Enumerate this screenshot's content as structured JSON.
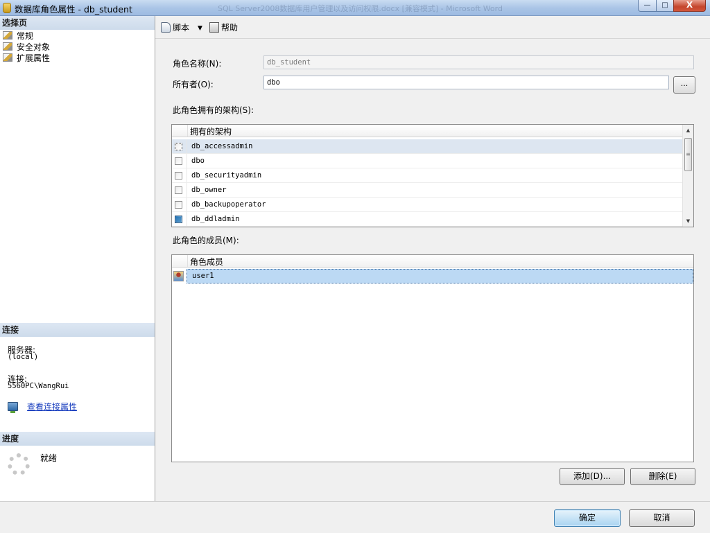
{
  "window": {
    "title": "数据库角色属性 - db_student",
    "background_title": "SQL Server2008数据库用户管理以及访问权限.docx [兼容模式] - Microsoft Word",
    "controls": {
      "minimize": "—",
      "maximize": "□",
      "close": "X"
    }
  },
  "left_panel": {
    "select_page_header": "选择页",
    "pages": [
      {
        "label": "常规"
      },
      {
        "label": "安全对象"
      },
      {
        "label": "扩展属性"
      }
    ],
    "connection": {
      "header": "连接",
      "server_label": "服务器:",
      "server_value": "(local)",
      "connection_label": "连接:",
      "connection_value": "5560PC\\WangRui",
      "view_properties_link": "查看连接属性"
    },
    "progress": {
      "header": "进度",
      "status": "就绪"
    }
  },
  "toolbar": {
    "script_label": "脚本",
    "dropdown_arrow": "▼",
    "help_label": "帮助"
  },
  "form": {
    "role_name_label": "角色名称(N):",
    "role_name_value": "db_student",
    "owner_label": "所有者(O):",
    "owner_value": "dbo",
    "browse_button": "...",
    "schemas_label": "此角色拥有的架构(S):",
    "schemas_column": "拥有的架构",
    "schemas": [
      {
        "name": "db_accessadmin",
        "checked": false
      },
      {
        "name": "dbo",
        "checked": false
      },
      {
        "name": "db_securityadmin",
        "checked": false
      },
      {
        "name": "db_owner",
        "checked": false
      },
      {
        "name": "db_backupoperator",
        "checked": false
      },
      {
        "name": "db_ddladmin",
        "checked": true
      }
    ],
    "members_label": "此角色的成员(M):",
    "members_column": "角色成员",
    "members": [
      {
        "name": "user1"
      }
    ],
    "add_button": "添加(D)...",
    "remove_button": "删除(E)"
  },
  "footer": {
    "ok_button": "确定",
    "cancel_button": "取消"
  },
  "colors": {
    "selected_member": "#bcd9f4",
    "link": "#1a3fbf",
    "section_header": "#d5e1ef"
  }
}
